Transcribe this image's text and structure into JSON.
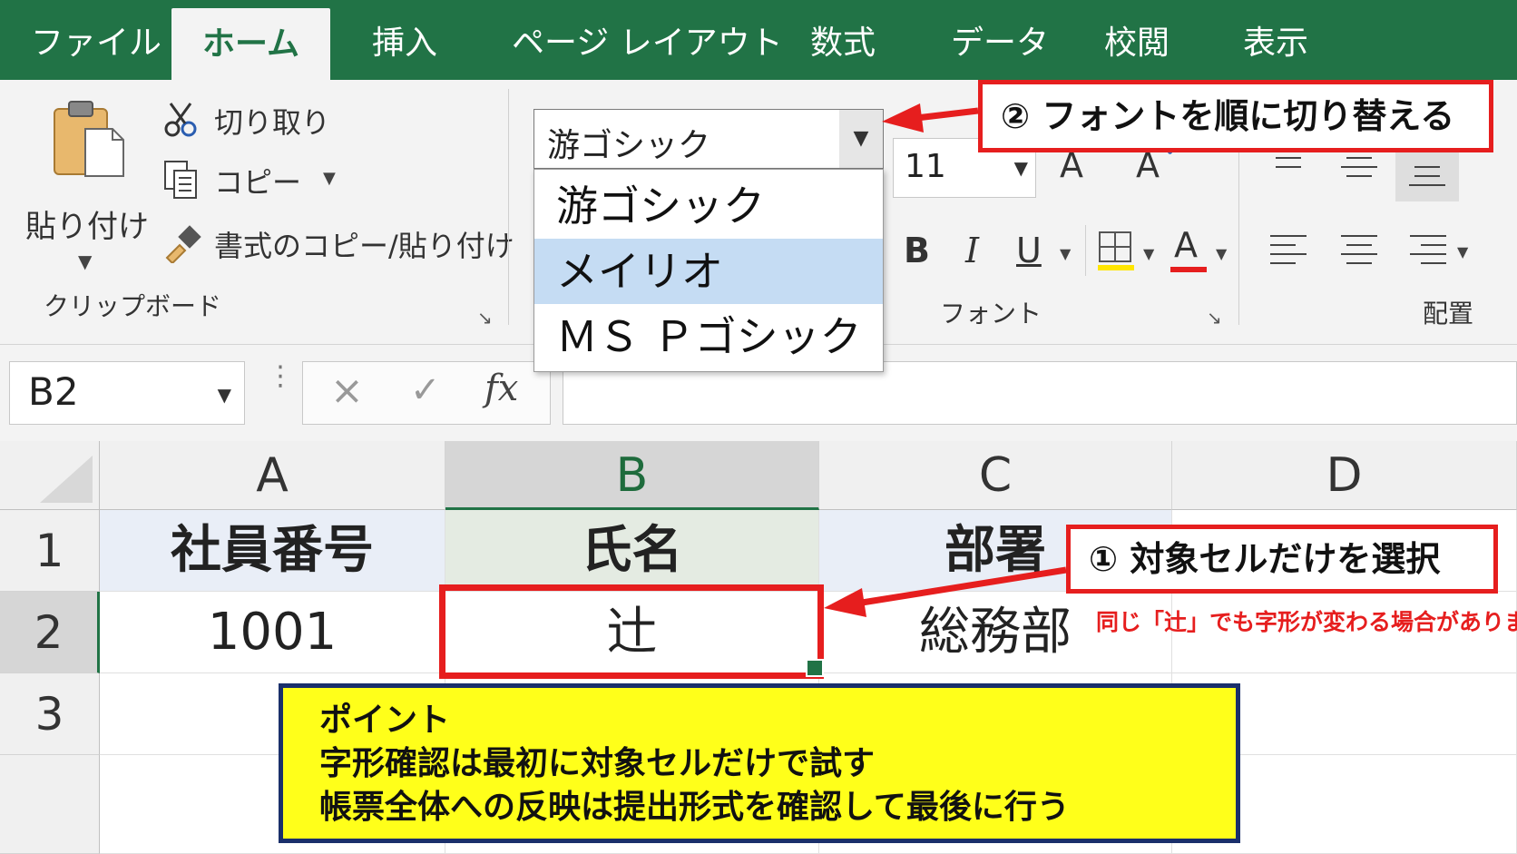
{
  "ribbon_tabs": [
    {
      "label": "ファイル"
    },
    {
      "label": "ホーム",
      "active": true
    },
    {
      "label": "挿入"
    },
    {
      "label": "ページ レイアウト"
    },
    {
      "label": "数式"
    },
    {
      "label": "データ"
    },
    {
      "label": "校閲"
    },
    {
      "label": "表示"
    }
  ],
  "clipboard": {
    "paste_label": "貼り付け",
    "cut_label": "切り取り",
    "copy_label": "コピー",
    "format_painter_label": "書式のコピー/貼り付け",
    "group_label": "クリップボード"
  },
  "font": {
    "font_name": "游ゴシック",
    "font_size": "11",
    "grow_label": "A",
    "shrink_label": "A",
    "bold_label": "B",
    "italic_label": "I",
    "underline_label": "U",
    "font_color_label": "A",
    "group_label": "フォント",
    "dropdown_options": [
      "游ゴシック",
      "メイリオ",
      "ＭＳ Ｐゴシック"
    ],
    "dropdown_selected": "メイリオ"
  },
  "alignment": {
    "group_label": "配置"
  },
  "formula_bar": {
    "name_box": "B2",
    "cancel_icon": "×",
    "enter_icon": "✓",
    "fx_label": "fx",
    "formula": ""
  },
  "sheet": {
    "columns": [
      "A",
      "B",
      "C",
      "D"
    ],
    "rows": [
      "1",
      "2",
      "3"
    ],
    "row1": [
      "社員番号",
      "氏名",
      "部署",
      ""
    ],
    "row2": [
      "1001",
      "辻",
      "総務部",
      ""
    ],
    "selected_cell": "B2"
  },
  "annotations": {
    "step1": "① 対象セルだけを選択",
    "step2": "② フォントを順に切り替える",
    "note": "同じ「辻」でも字形が変わる場合があります",
    "point_title": "ポイント",
    "point_line1": "字形確認は最初に対象セルだけで試す",
    "point_line2": "帳票全体への反映は提出形式を確認して最後に行う"
  },
  "colors": {
    "excel_green": "#217346",
    "callout_red": "#e61e1e",
    "point_yellow": "#ffff1a",
    "point_border": "#1a2f6b",
    "dropdown_highlight": "#c5dcf3"
  }
}
